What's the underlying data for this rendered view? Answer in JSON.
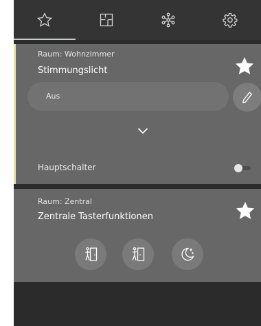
{
  "tabs": [
    {
      "icon": "star-icon",
      "active": true
    },
    {
      "icon": "floorplan-icon",
      "active": false
    },
    {
      "icon": "network-icon",
      "active": false
    },
    {
      "icon": "gear-icon",
      "active": false
    }
  ],
  "cards": [
    {
      "room": "Raum: Wohnzimmer",
      "title": "Stimmungslicht",
      "favorite": true,
      "scene_value": "Aus",
      "main_switch_label": "Hauptschalter",
      "main_switch_on": false,
      "accent_color": "#e4e2a4"
    },
    {
      "room": "Raum: Zentral",
      "title": "Zentrale Tasterfunktionen",
      "favorite": true,
      "functions": [
        {
          "icon": "person-door-enter-icon"
        },
        {
          "icon": "person-door-leave-icon"
        },
        {
          "icon": "moon-stars-icon"
        }
      ]
    }
  ],
  "colors": {
    "background": "#2b2b2b",
    "tabbar": "#343434",
    "card": "#676767"
  }
}
